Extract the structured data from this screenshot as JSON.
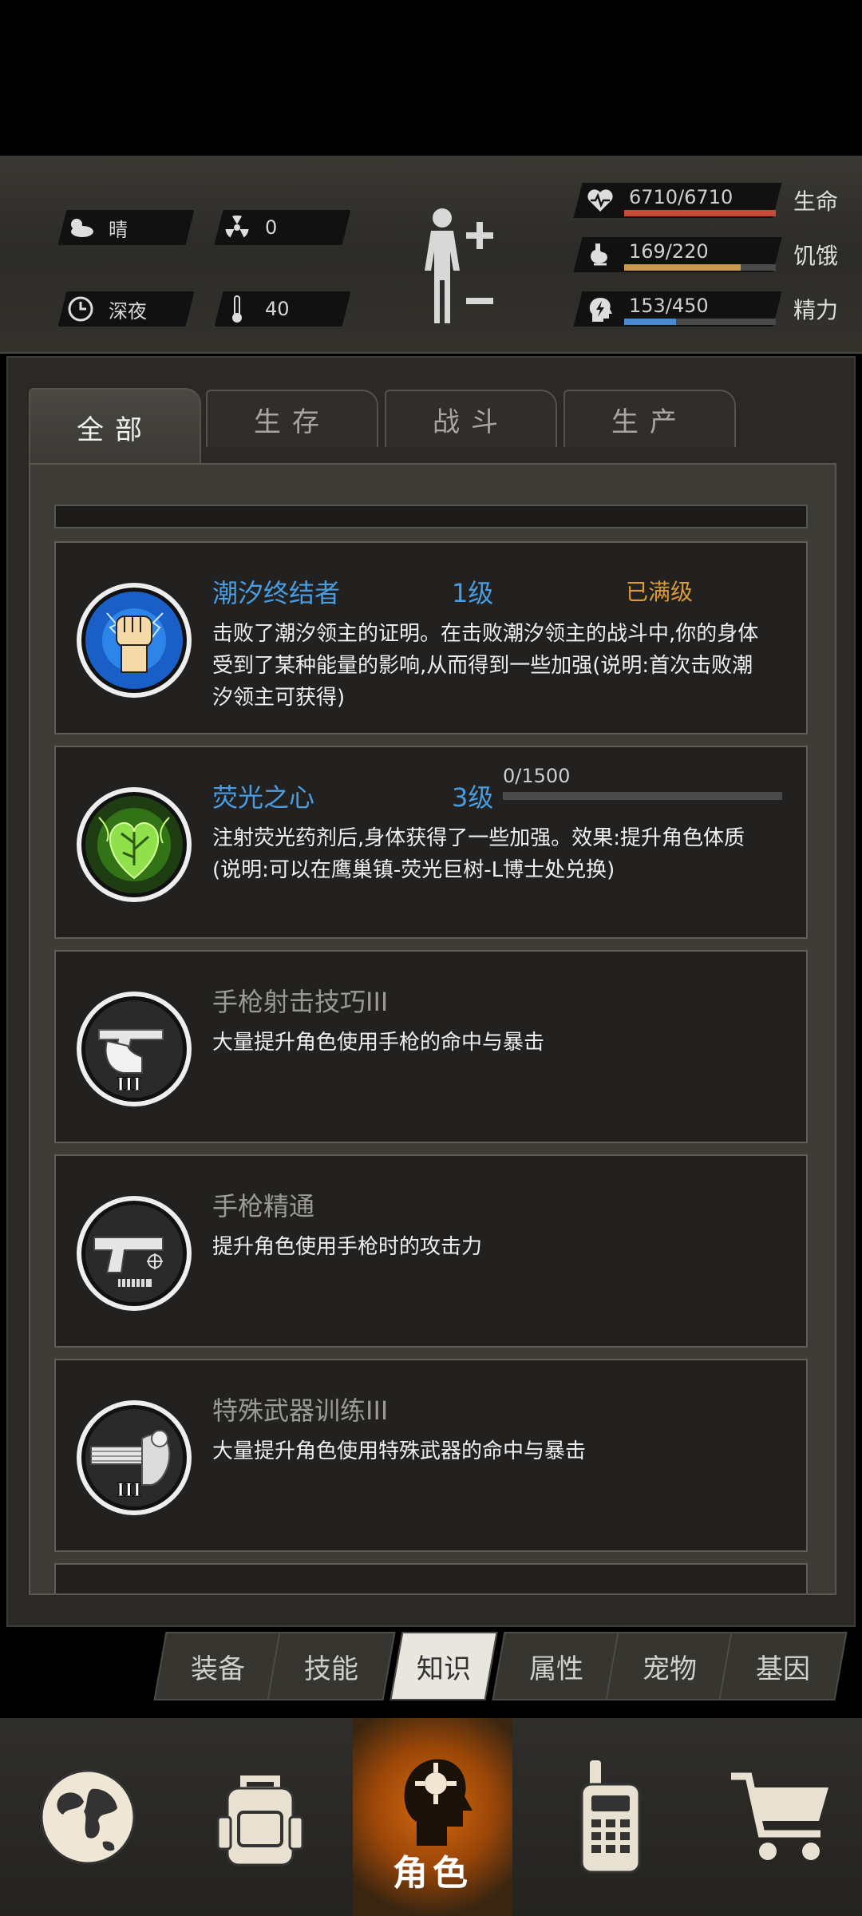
{
  "status": {
    "weather": "晴",
    "radiation": "0",
    "time_of_day": "深夜",
    "temperature": "40",
    "bars": [
      {
        "name": "health",
        "value_text": "6710/6710",
        "label": "生命",
        "fraction": 1.0,
        "color": "#c84a3a",
        "icon": "heart-pulse-icon"
      },
      {
        "name": "hunger",
        "value_text": "169/220",
        "label": "饥饿",
        "fraction": 0.77,
        "color": "#c89a4a",
        "icon": "stomach-icon"
      },
      {
        "name": "energy",
        "value_text": "153/450",
        "label": "精力",
        "fraction": 0.34,
        "color": "#4a8ad0",
        "icon": "head-bolt-icon"
      }
    ]
  },
  "tabs": [
    "全部",
    "生存",
    "战斗",
    "生产"
  ],
  "active_tab": "全部",
  "cards": [
    {
      "title": "潮汐终结者",
      "level": "1级",
      "status": "已满级",
      "desc": "击败了潮汐领主的证明。在击败潮汐领主的战斗中,你的身体受到了某种能量的影响,从而得到一些加强(说明:首次击败潮汐领主可获得)",
      "icon": "fist-lightning-icon"
    },
    {
      "title": "荧光之心",
      "level": "3级",
      "progress_text": "0/1500",
      "progress": 0.0,
      "desc": "注射荧光药剂后,身体获得了一些加强。效果:提升角色体质(说明:可以在鹰巢镇-荧光巨树-L博士处兑换)",
      "icon": "glowing-heart-icon"
    },
    {
      "title": "手枪射击技巧III",
      "desc": "大量提升角色使用手枪的命中与暴击",
      "icon": "pistol-hand-icon"
    },
    {
      "title": "手枪精通",
      "desc": "提升角色使用手枪时的攻击力",
      "icon": "pistol-icon"
    },
    {
      "title": "特殊武器训练III",
      "desc": "大量提升角色使用特殊武器的命中与暴击",
      "icon": "minigun-icon"
    }
  ],
  "subtabs": [
    "装备",
    "技能",
    "知识",
    "属性",
    "宠物",
    "基因"
  ],
  "active_subtab": "知识",
  "nav": {
    "active_label": "角色",
    "items": [
      "globe-icon",
      "backpack-icon",
      "character-icon",
      "radio-icon",
      "cart-icon"
    ]
  }
}
